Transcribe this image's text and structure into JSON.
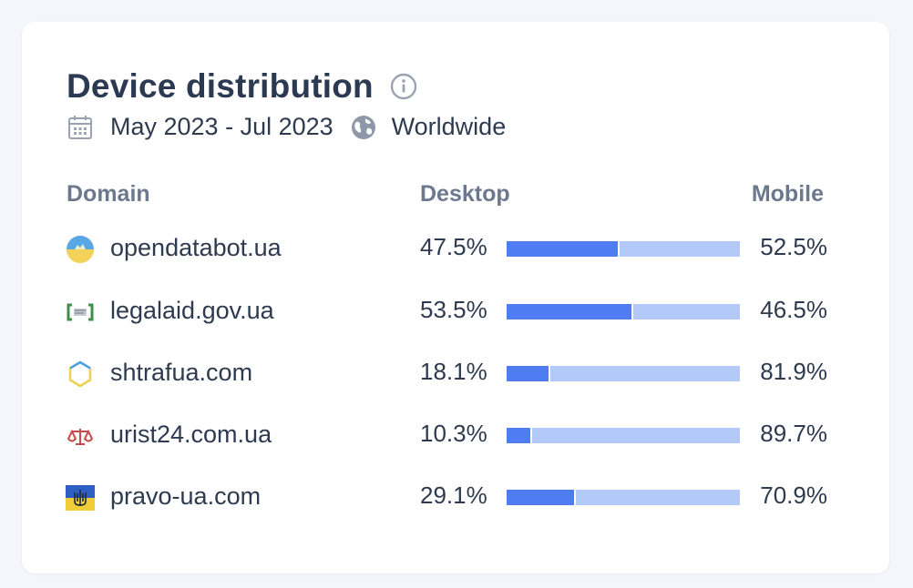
{
  "widget": {
    "title": "Device distribution",
    "date_range": "May 2023 - Jul 2023",
    "region": "Worldwide"
  },
  "columns": {
    "domain": "Domain",
    "desktop": "Desktop",
    "mobile": "Mobile"
  },
  "colors": {
    "desktop_bar": "#4f7cf0",
    "mobile_bar": "#b3c9f7"
  },
  "rows": [
    {
      "domain": "opendatabot.ua",
      "desktop": "47.5%",
      "mobile": "52.5%",
      "desktop_share": 47.5,
      "favicon": "ua-globe-icon"
    },
    {
      "domain": "legalaid.gov.ua",
      "desktop": "53.5%",
      "mobile": "46.5%",
      "desktop_share": 53.5,
      "favicon": "bracket-logo-icon"
    },
    {
      "domain": "shtrafua.com",
      "desktop": "18.1%",
      "mobile": "81.9%",
      "desktop_share": 18.1,
      "favicon": "hexagon-icon"
    },
    {
      "domain": "urist24.com.ua",
      "desktop": "10.3%",
      "mobile": "89.7%",
      "desktop_share": 10.3,
      "favicon": "scales-icon"
    },
    {
      "domain": "pravo-ua.com",
      "desktop": "29.1%",
      "mobile": "70.9%",
      "desktop_share": 29.1,
      "favicon": "ua-flag-trident-icon"
    }
  ]
}
